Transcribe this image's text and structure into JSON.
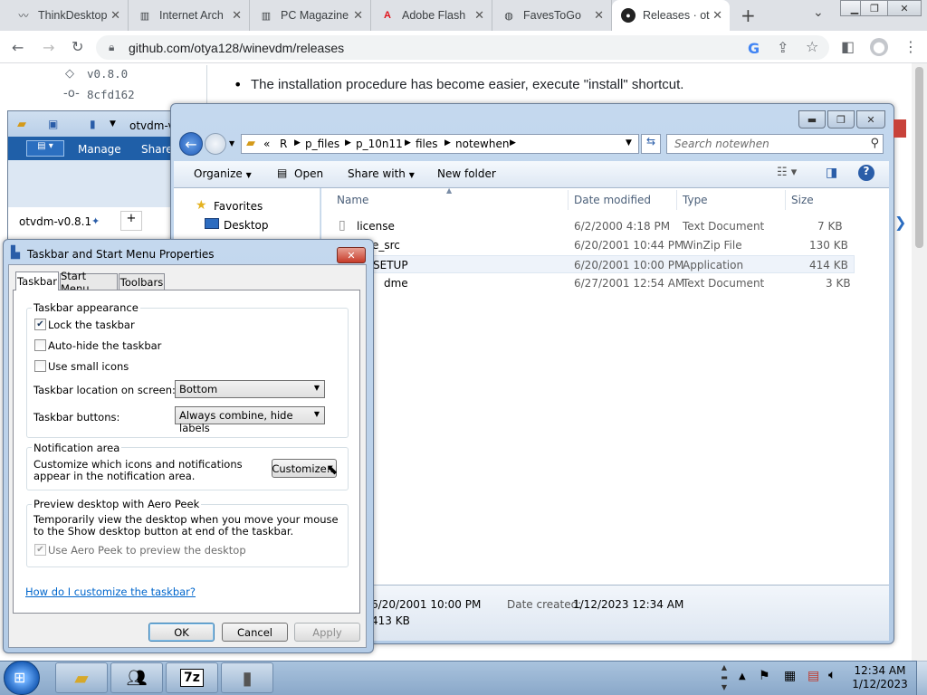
{
  "browser": {
    "tabs": [
      {
        "label": "ThinkDesktop",
        "favicon": "think-icon"
      },
      {
        "label": "Internet Arch",
        "favicon": "archive-icon"
      },
      {
        "label": "PC Magazine",
        "favicon": "archive-icon"
      },
      {
        "label": "Adobe Flash",
        "favicon": "adobe-icon"
      },
      {
        "label": "FavesToGo",
        "favicon": "globe-icon"
      },
      {
        "label": "Releases · ot",
        "favicon": "github-icon",
        "active": true
      }
    ],
    "url": "github.com/otya128/winevdm/releases"
  },
  "webpage": {
    "tag": "v0.8.0",
    "commit": "8cfd162",
    "bullet": "The installation procedure has become easier, execute \"install\" shortcut."
  },
  "otvdm_window": {
    "title": "otvdm-v",
    "ribbon_tabs": [
      "Manage",
      "Share"
    ],
    "tab_label": "otvdm-v0.8.1"
  },
  "explorer": {
    "breadcrumb": [
      "«",
      "R",
      "p_files",
      "p_10n11",
      "files",
      "notewhen"
    ],
    "search_placeholder": "Search notewhen",
    "commands": {
      "organize": "Organize",
      "open": "Open",
      "share": "Share with",
      "new_folder": "New folder"
    },
    "nav": [
      {
        "label": "Favorites"
      },
      {
        "label": "Desktop"
      }
    ],
    "columns": {
      "name": "Name",
      "date": "Date modified",
      "type": "Type",
      "size": "Size"
    },
    "files": [
      {
        "name": "license",
        "date": "6/2/2000 4:18 PM",
        "type": "Text Document",
        "size": "7 KB"
      },
      {
        "name": "e_src",
        "date": "6/20/2001 10:44 PM",
        "type": "WinZip File",
        "size": "130 KB"
      },
      {
        "name": "SETUP",
        "date": "6/20/2001 10:00 PM",
        "type": "Application",
        "size": "414 KB"
      },
      {
        "name": "dme",
        "date": "6/27/2001 12:54 AM",
        "type": "Text Document",
        "size": "3 KB"
      }
    ],
    "details": {
      "modified": "6/20/2001 10:00 PM",
      "created_label": "Date created:",
      "created": "1/12/2023 12:34 AM",
      "size": "413 KB"
    }
  },
  "dialog": {
    "title": "Taskbar and Start Menu Properties",
    "tabs": [
      "Taskbar",
      "Start Menu",
      "Toolbars"
    ],
    "appearance_group": "Taskbar appearance",
    "lock": {
      "label": "Lock the taskbar",
      "checked": true
    },
    "autohide": {
      "label": "Auto-hide the taskbar",
      "checked": false
    },
    "small_icons": {
      "label": "Use small icons",
      "checked": false
    },
    "location_label": "Taskbar location on screen:",
    "location_value": "Bottom",
    "buttons_label": "Taskbar buttons:",
    "buttons_value": "Always combine, hide labels",
    "notification_group": "Notification area",
    "notification_text": "Customize which icons and notifications appear in the notification area.",
    "customize_button": "Customize...",
    "peek_group": "Preview desktop with Aero Peek",
    "peek_text": "Temporarily view the desktop when you move your mouse to the Show desktop button at end of the taskbar.",
    "peek_check": {
      "label": "Use Aero Peek to preview the desktop",
      "checked": true
    },
    "help_link": "How do I customize the taskbar?",
    "ok": "OK",
    "cancel": "Cancel",
    "apply": "Apply"
  },
  "taskbar": {
    "time": "12:34 AM",
    "date": "1/12/2023",
    "apps": [
      "explorer-icon",
      "users-icon",
      "7zip-icon",
      "computer-icon"
    ],
    "sevenzip_label": "7z"
  }
}
